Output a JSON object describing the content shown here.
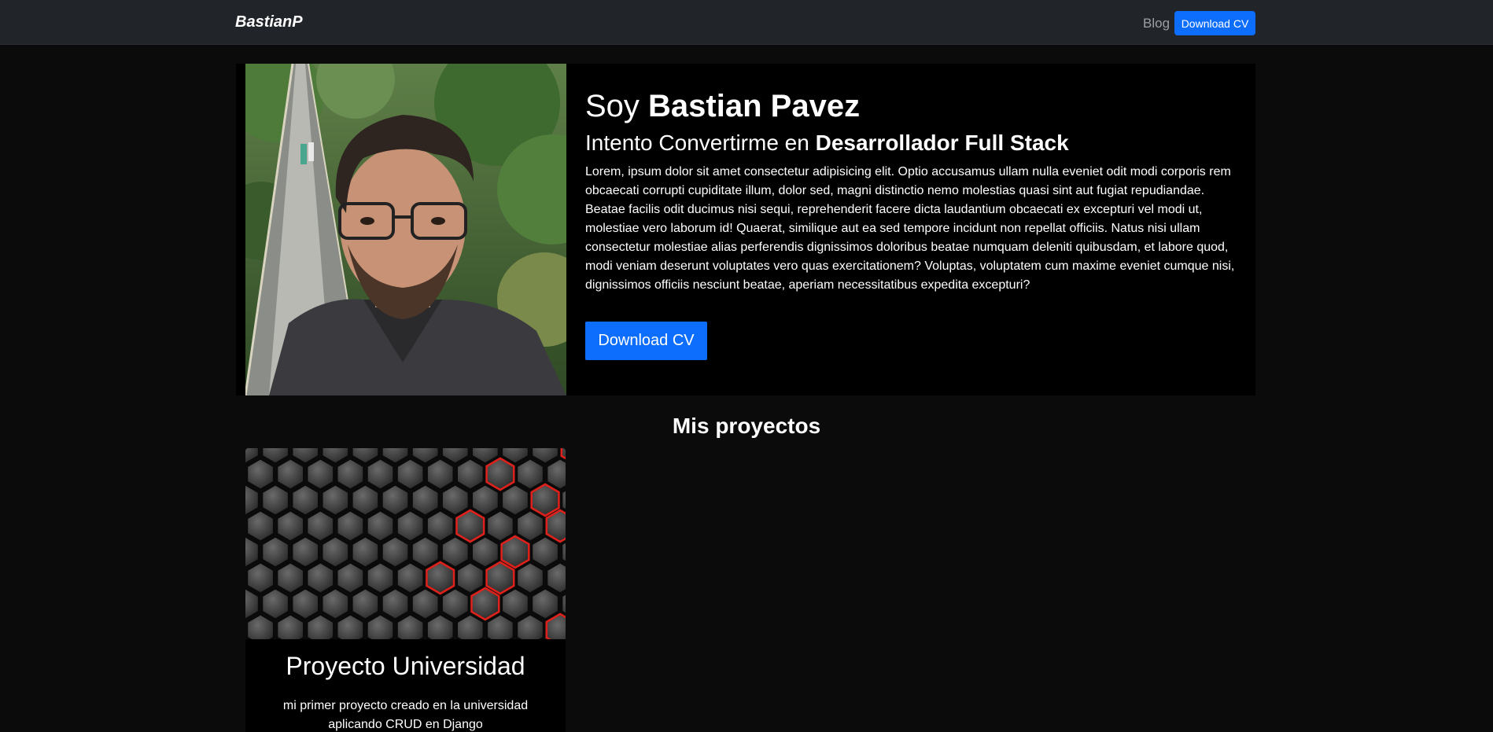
{
  "navbar": {
    "brand": "BastianP",
    "links": {
      "blog": "Blog"
    },
    "cv_button": "Download CV"
  },
  "hero": {
    "title_prefix": "Soy ",
    "title_name": "Bastian Pavez",
    "subtitle_prefix": "Intento Convertirme en ",
    "subtitle_role": "Desarrollador Full Stack",
    "body": "Lorem, ipsum dolor sit amet consectetur adipisicing elit. Optio accusamus ullam nulla eveniet odit modi corporis rem obcaecati corrupti cupiditate illum, dolor sed, magni distinctio nemo molestias quasi sint aut fugiat repudiandae. Beatae facilis odit ducimus nisi sequi, reprehenderit facere dicta laudantium obcaecati ex excepturi vel modi ut, molestiae vero laborum id! Quaerat, similique aut ea sed tempore incidunt non repellat officiis. Natus nisi ullam consectetur molestiae alias perferendis dignissimos doloribus beatae numquam deleniti quibusdam, et labore quod, modi veniam deserunt voluptates vero quas exercitationem? Voluptas, voluptatem cum maxime eveniet cumque nisi, dignissimos officiis nesciunt beatae, aperiam necessitatibus expedita excepturi?",
    "cv_button": "Download CV"
  },
  "projects": {
    "section_title": "Mis proyectos",
    "items": [
      {
        "title": "Proyecto Universidad",
        "description": "mi primer proyecto creado en la universidad aplicando CRUD en Django"
      }
    ]
  },
  "colors": {
    "page_bg": "#0b0b0c",
    "navbar_bg": "#212529",
    "accent": "#0d6efd",
    "hex_glow": "#e0201a"
  },
  "icons": []
}
